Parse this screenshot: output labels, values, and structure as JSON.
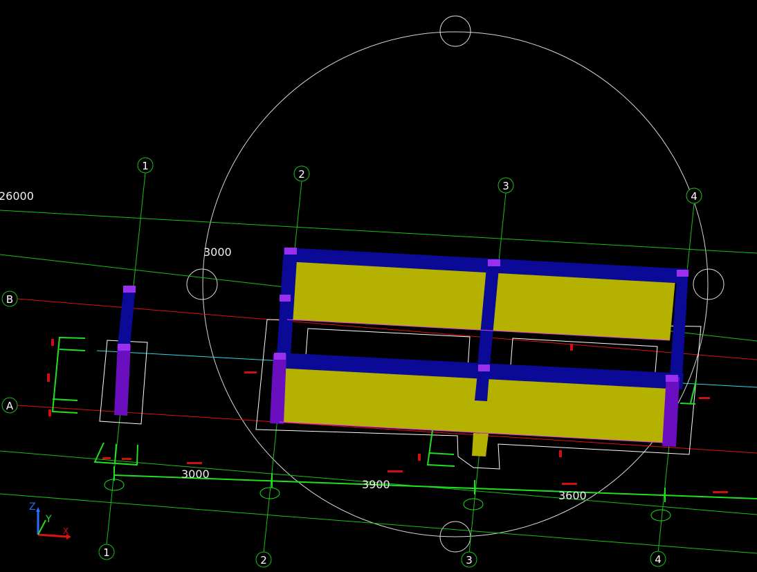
{
  "grid_axes": {
    "top_labels": [
      "1",
      "2",
      "3",
      "4"
    ],
    "bottom_labels": [
      "1",
      "2",
      "3",
      "4"
    ],
    "row_labels": [
      "B",
      "A"
    ]
  },
  "dimensions": {
    "total": "26000",
    "bay_top": "3000",
    "bays": [
      "3000",
      "3900",
      "3600"
    ]
  },
  "ucs": {
    "z": "Z",
    "y": "Y",
    "x": "X"
  },
  "colors": {
    "background": "#000000",
    "beam": "#0a0a96",
    "column": "#6a0fc0",
    "slab": "#b5b100",
    "axis": "#18c018",
    "red_axis": "#e01010",
    "cyan_line": "#30d8e8",
    "outline": "#ffffff",
    "dim_line": "#20e020"
  }
}
